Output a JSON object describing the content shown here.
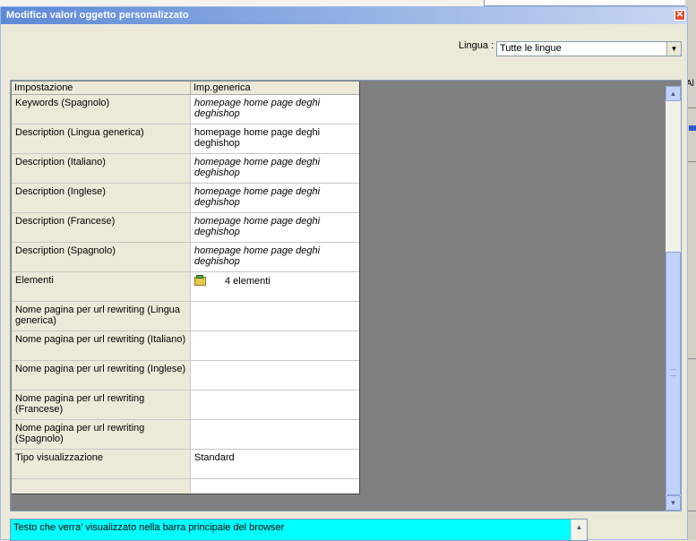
{
  "window": {
    "title": "Modifica valori oggetto personalizzato",
    "close_glyph": "✕"
  },
  "lingua": {
    "label": "Lingua :",
    "selected": "Tutte le lingue",
    "arrow": "▼"
  },
  "grid": {
    "headers": [
      "Impostazione",
      "Imp.generica"
    ],
    "rows": [
      {
        "setting": "Keywords (Spagnolo)",
        "value": "homepage home page deghi deghishop",
        "inherited": true
      },
      {
        "setting": "Description (Lingua generica)",
        "value": "homepage home page deghi deghishop",
        "inherited": false
      },
      {
        "setting": "Description (Italiano)",
        "value": "homepage home page deghi deghishop",
        "inherited": true
      },
      {
        "setting": "Description (Inglese)",
        "value": "homepage home page deghi deghishop",
        "inherited": true
      },
      {
        "setting": "Description (Francese)",
        "value": "homepage home page deghi deghishop",
        "inherited": true
      },
      {
        "setting": "Description (Spagnolo)",
        "value": "homepage home page deghi deghishop",
        "inherited": true
      },
      {
        "setting": "Elementi",
        "value": "4 elementi",
        "inherited": false,
        "icon": "folder-icon"
      },
      {
        "setting": "Nome pagina per url rewriting (Lingua generica)",
        "value": "",
        "inherited": false
      },
      {
        "setting": "Nome pagina per url rewriting (Italiano)",
        "value": "",
        "inherited": false
      },
      {
        "setting": "Nome pagina per url rewriting (Inglese)",
        "value": "",
        "inherited": false
      },
      {
        "setting": "Nome pagina per url rewriting (Francese)",
        "value": "",
        "inherited": false
      },
      {
        "setting": "Nome pagina per url rewriting (Spagnolo)",
        "value": "",
        "inherited": false
      },
      {
        "setting": "Tipo visualizzazione",
        "value": "Standard",
        "inherited": false
      },
      {
        "setting": "",
        "value": "",
        "inherited": false
      }
    ]
  },
  "scrollbar": {
    "up": "▲",
    "down": "▼"
  },
  "description": {
    "text": "Testo che verra' visualizzato nella barra principale del browser",
    "bg_color": "#00ffff",
    "scroll_up": "▲"
  },
  "background_window": {
    "edge_label": "Al"
  }
}
